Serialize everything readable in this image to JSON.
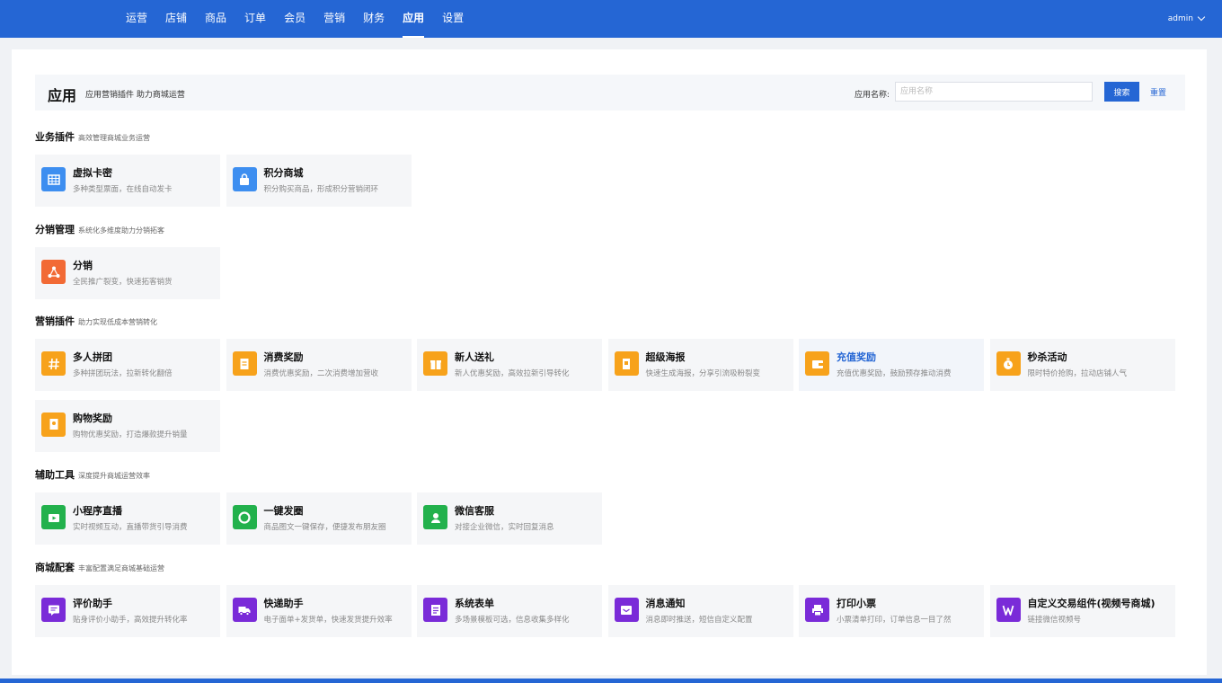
{
  "nav": {
    "items": [
      "运营",
      "店铺",
      "商品",
      "订单",
      "会员",
      "营销",
      "财务",
      "应用",
      "设置"
    ],
    "active_index": 7,
    "user": "admin"
  },
  "header": {
    "title": "应用",
    "subtitle": "应用营销插件 助力商城运营",
    "search_label": "应用名称:",
    "search_placeholder": "应用名称",
    "search_button": "搜索",
    "reset_link": "重置"
  },
  "sections": [
    {
      "title": "业务插件",
      "subtitle": "高效管理商城业务运营",
      "apps": [
        {
          "name": "虚拟卡密",
          "desc": "多种类型票面，在线自动发卡",
          "color": "#3d8ef0",
          "icon": "grid-icon"
        },
        {
          "name": "积分商城",
          "desc": "积分购买商品，形成积分营销闭环",
          "color": "#3d8ef0",
          "icon": "bag-icon"
        }
      ]
    },
    {
      "title": "分销管理",
      "subtitle": "系统化多维度助力分销拓客",
      "apps": [
        {
          "name": "分销",
          "desc": "全民推广裂变，快速拓客销货",
          "color": "#f26a35",
          "icon": "share-icon"
        }
      ]
    },
    {
      "title": "营销插件",
      "subtitle": "助力实现低成本营销转化",
      "apps": [
        {
          "name": "多人拼团",
          "desc": "多种拼团玩法，拉新转化翻倍",
          "color": "#f7a21b",
          "icon": "hash-icon"
        },
        {
          "name": "消费奖励",
          "desc": "消费优惠奖励，二次消费增加营收",
          "color": "#f7a21b",
          "icon": "receipt-icon"
        },
        {
          "name": "新人送礼",
          "desc": "新人优惠奖励，高效拉新引导转化",
          "color": "#f7a21b",
          "icon": "gift-icon"
        },
        {
          "name": "超级海报",
          "desc": "快速生成海报，分享引流吸粉裂变",
          "color": "#f7a21b",
          "icon": "poster-icon"
        },
        {
          "name": "充值奖励",
          "desc": "充值优惠奖励，鼓励预存推动消费",
          "color": "#f7a21b",
          "icon": "wallet-icon"
        },
        {
          "name": "秒杀活动",
          "desc": "限时特价抢购，拉动店铺人气",
          "color": "#f7a21b",
          "icon": "timer-icon"
        },
        {
          "name": "购物奖励",
          "desc": "购物优惠奖励，打造爆款提升销量",
          "color": "#f7a21b",
          "icon": "card-icon"
        }
      ]
    },
    {
      "title": "辅助工具",
      "subtitle": "深度提升商城运营效率",
      "apps": [
        {
          "name": "小程序直播",
          "desc": "实时视频互动，直播带货引导消费",
          "color": "#22b14c",
          "icon": "live-icon"
        },
        {
          "name": "一键发圈",
          "desc": "商品图文一键保存，便捷发布朋友圈",
          "color": "#22b14c",
          "icon": "circle-icon"
        },
        {
          "name": "微信客服",
          "desc": "对接企业微信，实时回复消息",
          "color": "#22b14c",
          "icon": "service-icon"
        }
      ]
    },
    {
      "title": "商城配套",
      "subtitle": "丰富配置满足商城基础运营",
      "apps": [
        {
          "name": "评价助手",
          "desc": "贴身评价小助手，高效提升转化率",
          "color": "#7a2bd8",
          "icon": "comment-icon"
        },
        {
          "name": "快递助手",
          "desc": "电子面单+发货单，快速发货提升效率",
          "color": "#7a2bd8",
          "icon": "truck-icon"
        },
        {
          "name": "系统表单",
          "desc": "多场景模板可选，信息收集多样化",
          "color": "#7a2bd8",
          "icon": "form-icon"
        },
        {
          "name": "消息通知",
          "desc": "消息即时推送，短信自定义配置",
          "color": "#7a2bd8",
          "icon": "message-icon"
        },
        {
          "name": "打印小票",
          "desc": "小票清单打印，订单信息一目了然",
          "color": "#7a2bd8",
          "icon": "printer-icon"
        },
        {
          "name": "自定义交易组件(视频号商城)",
          "desc": "链接微信视频号",
          "color": "#7a2bd8",
          "icon": "video-channel-icon"
        }
      ]
    }
  ]
}
